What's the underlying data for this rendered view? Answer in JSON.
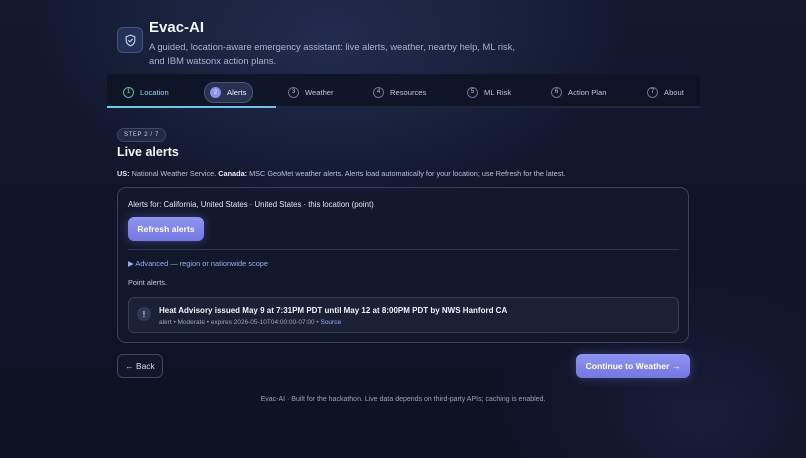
{
  "app": {
    "title": "Evac-AI",
    "subtitle": "A guided, location-aware emergency assistant: live alerts, weather, nearby help, ML risk, and IBM watsonx action plans.",
    "logo_icon": "shield-check-icon"
  },
  "stepper": {
    "steps": [
      {
        "num": "1",
        "label": "Location",
        "state": "done"
      },
      {
        "num": "2",
        "label": "Alerts",
        "state": "active"
      },
      {
        "num": "3",
        "label": "Weather",
        "state": "pending"
      },
      {
        "num": "4",
        "label": "Resources",
        "state": "pending"
      },
      {
        "num": "5",
        "label": "ML Risk",
        "state": "pending"
      },
      {
        "num": "6",
        "label": "Action Plan",
        "state": "pending"
      },
      {
        "num": "7",
        "label": "About",
        "state": "pending"
      }
    ],
    "progress_fraction": 0.2857
  },
  "step_pill": "STEP 2 / 7",
  "section_title": "Live alerts",
  "description": {
    "us_label": "US:",
    "us_text": " National Weather Service. ",
    "canada_label": "Canada:",
    "canada_text": " MSC GeoMet weather alerts. Alerts load automatically for your location; use Refresh for the latest."
  },
  "panel": {
    "alerts_for": "Alerts for: California, United States · United States · this location (point)",
    "refresh_label": "Refresh alerts",
    "advanced_label": "▶ Advanced — region or nationwide scope",
    "point_alerts_label": "Point alerts.",
    "alerts": [
      {
        "icon": "!",
        "title": "Heat Advisory issued May 9 at 7:31PM PDT until May 12 at 8:00PM PDT by NWS Hanford CA",
        "meta": "alert • Moderate • expires 2026-05-10T04:00:00-07:00 • ",
        "source_label": "Source"
      }
    ]
  },
  "nav": {
    "back_label": "← Back",
    "continue_label": "Continue to Weather →"
  },
  "footer": "Evac-AI · Built for the hackathon. Live data depends on third-party APIs; caching is enabled.",
  "colors": {
    "accent": "#7f83ea",
    "done": "#4fc3a1",
    "link": "#8fb0ee",
    "background": "#10152a"
  }
}
